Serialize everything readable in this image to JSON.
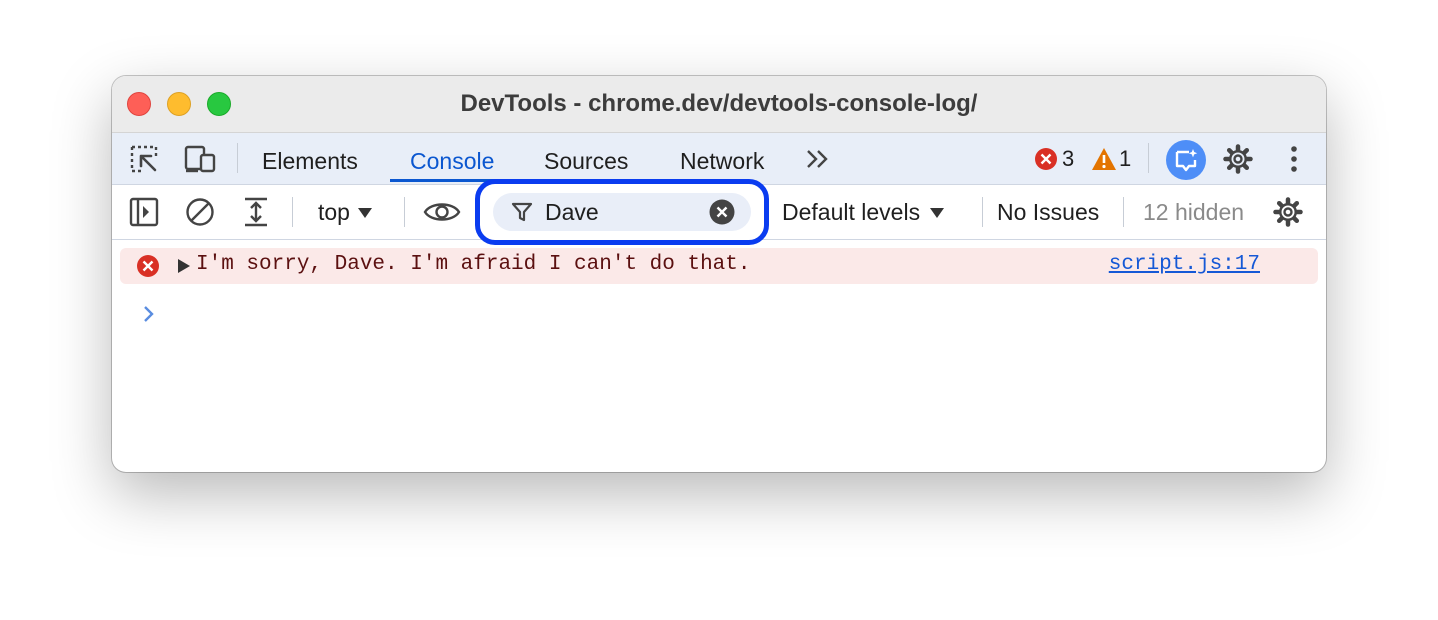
{
  "window": {
    "title": "DevTools - chrome.dev/devtools-console-log/"
  },
  "tabs": [
    {
      "label": "Elements",
      "active": false
    },
    {
      "label": "Console",
      "active": true
    },
    {
      "label": "Sources",
      "active": false
    },
    {
      "label": "Network",
      "active": false
    }
  ],
  "status": {
    "errors": "3",
    "warnings": "1"
  },
  "console_toolbar": {
    "context": "top",
    "filter_value": "Dave",
    "levels": "Default levels",
    "issues": "No Issues",
    "hidden": "12 hidden"
  },
  "messages": [
    {
      "level": "error",
      "text": "I'm sorry, Dave. I'm afraid I can't do that.",
      "source": "script.js:17"
    }
  ],
  "icons": {
    "inspect": "select-element-icon",
    "device": "device-toolbar-icon",
    "more_tabs": "chevron-double-right-icon",
    "error": "error-circle-icon",
    "warning": "warning-triangle-icon",
    "ai": "ai-assistance-icon",
    "settings": "gear-icon",
    "menu": "kebab-menu-icon",
    "sidebar": "sidebar-toggle-icon",
    "clear": "clear-console-icon",
    "expand": "expand-icon",
    "eye": "live-expression-icon",
    "filter": "filter-icon",
    "clear_filter": "clear-input-icon",
    "prompt": "chevron-right-icon"
  },
  "colors": {
    "accent": "#0b57d0",
    "highlight": "#0a3cf0",
    "error": "#d93025",
    "warning": "#e37400"
  }
}
